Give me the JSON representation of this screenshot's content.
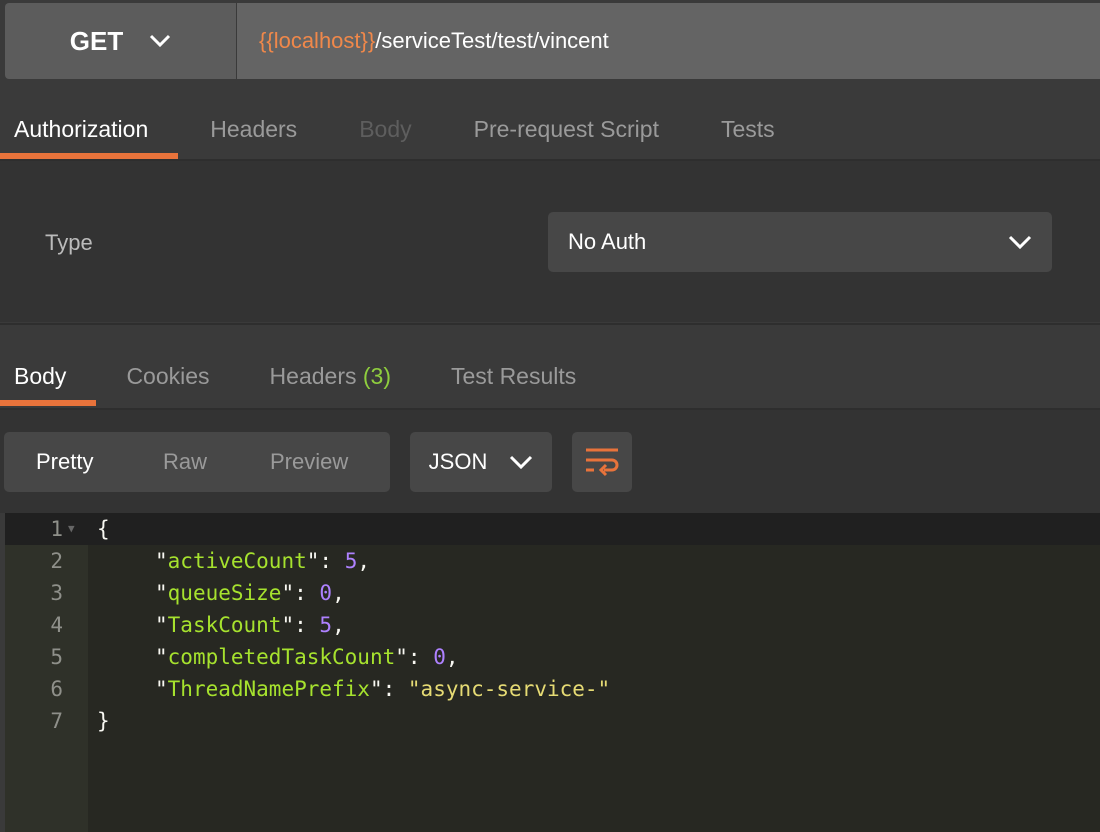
{
  "request": {
    "method": "GET",
    "url_variable": "{{localhost}}",
    "url_path": "/serviceTest/test/vincent"
  },
  "request_tabs": [
    {
      "label": "Authorization"
    },
    {
      "label": "Headers"
    },
    {
      "label": "Body"
    },
    {
      "label": "Pre-request Script"
    },
    {
      "label": "Tests"
    }
  ],
  "auth": {
    "type_label": "Type",
    "type_value": "No Auth"
  },
  "response_tabs": [
    {
      "label": "Body"
    },
    {
      "label": "Cookies"
    },
    {
      "label": "Headers",
      "count": "(3)"
    },
    {
      "label": "Test Results"
    }
  ],
  "view_modes": [
    "Pretty",
    "Raw",
    "Preview"
  ],
  "format": "JSON",
  "colors": {
    "accent": "#e8733b",
    "key": "#a6e22e",
    "number": "#ae81ff",
    "string": "#e6db74"
  },
  "code_lines": [
    {
      "n": "1",
      "text": "{"
    },
    {
      "n": "2",
      "key": "\"activeCount\"",
      "sep": ": ",
      "val": "5",
      "end": ","
    },
    {
      "n": "3",
      "key": "\"queueSize\"",
      "sep": ": ",
      "val": "0",
      "end": ","
    },
    {
      "n": "4",
      "key": "\"TaskCount\"",
      "sep": ": ",
      "val": "5",
      "end": ","
    },
    {
      "n": "5",
      "key": "\"completedTaskCount\"",
      "sep": ": ",
      "val": "0",
      "end": ","
    },
    {
      "n": "6",
      "key": "\"ThreadNamePrefix\"",
      "sep": ": ",
      "sval": "\"async-service-\"",
      "end": ""
    },
    {
      "n": "7",
      "text": "}"
    }
  ]
}
